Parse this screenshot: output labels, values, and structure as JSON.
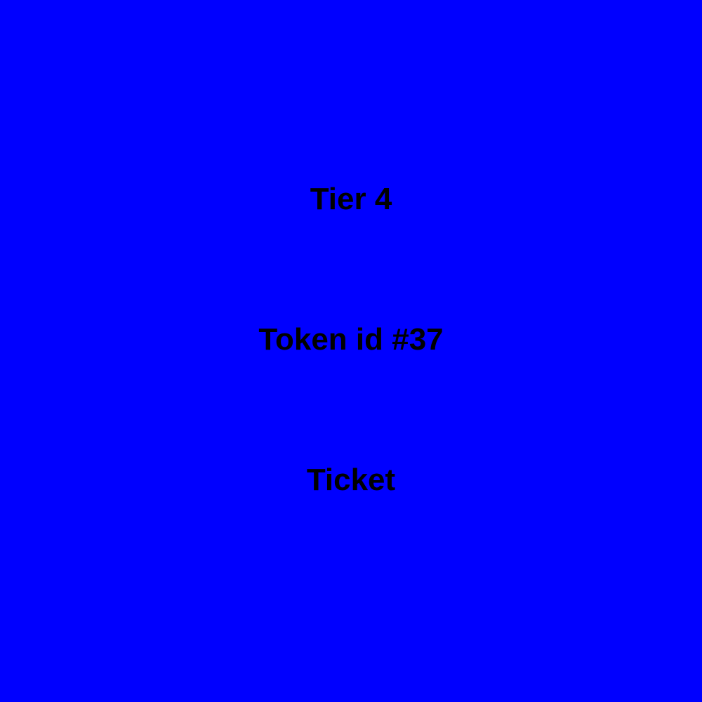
{
  "card": {
    "tier_text": "Tier 4",
    "token_text": "Token id #37",
    "type_text": "Ticket",
    "background_color": "#0000ff",
    "text_color": "#000000"
  }
}
